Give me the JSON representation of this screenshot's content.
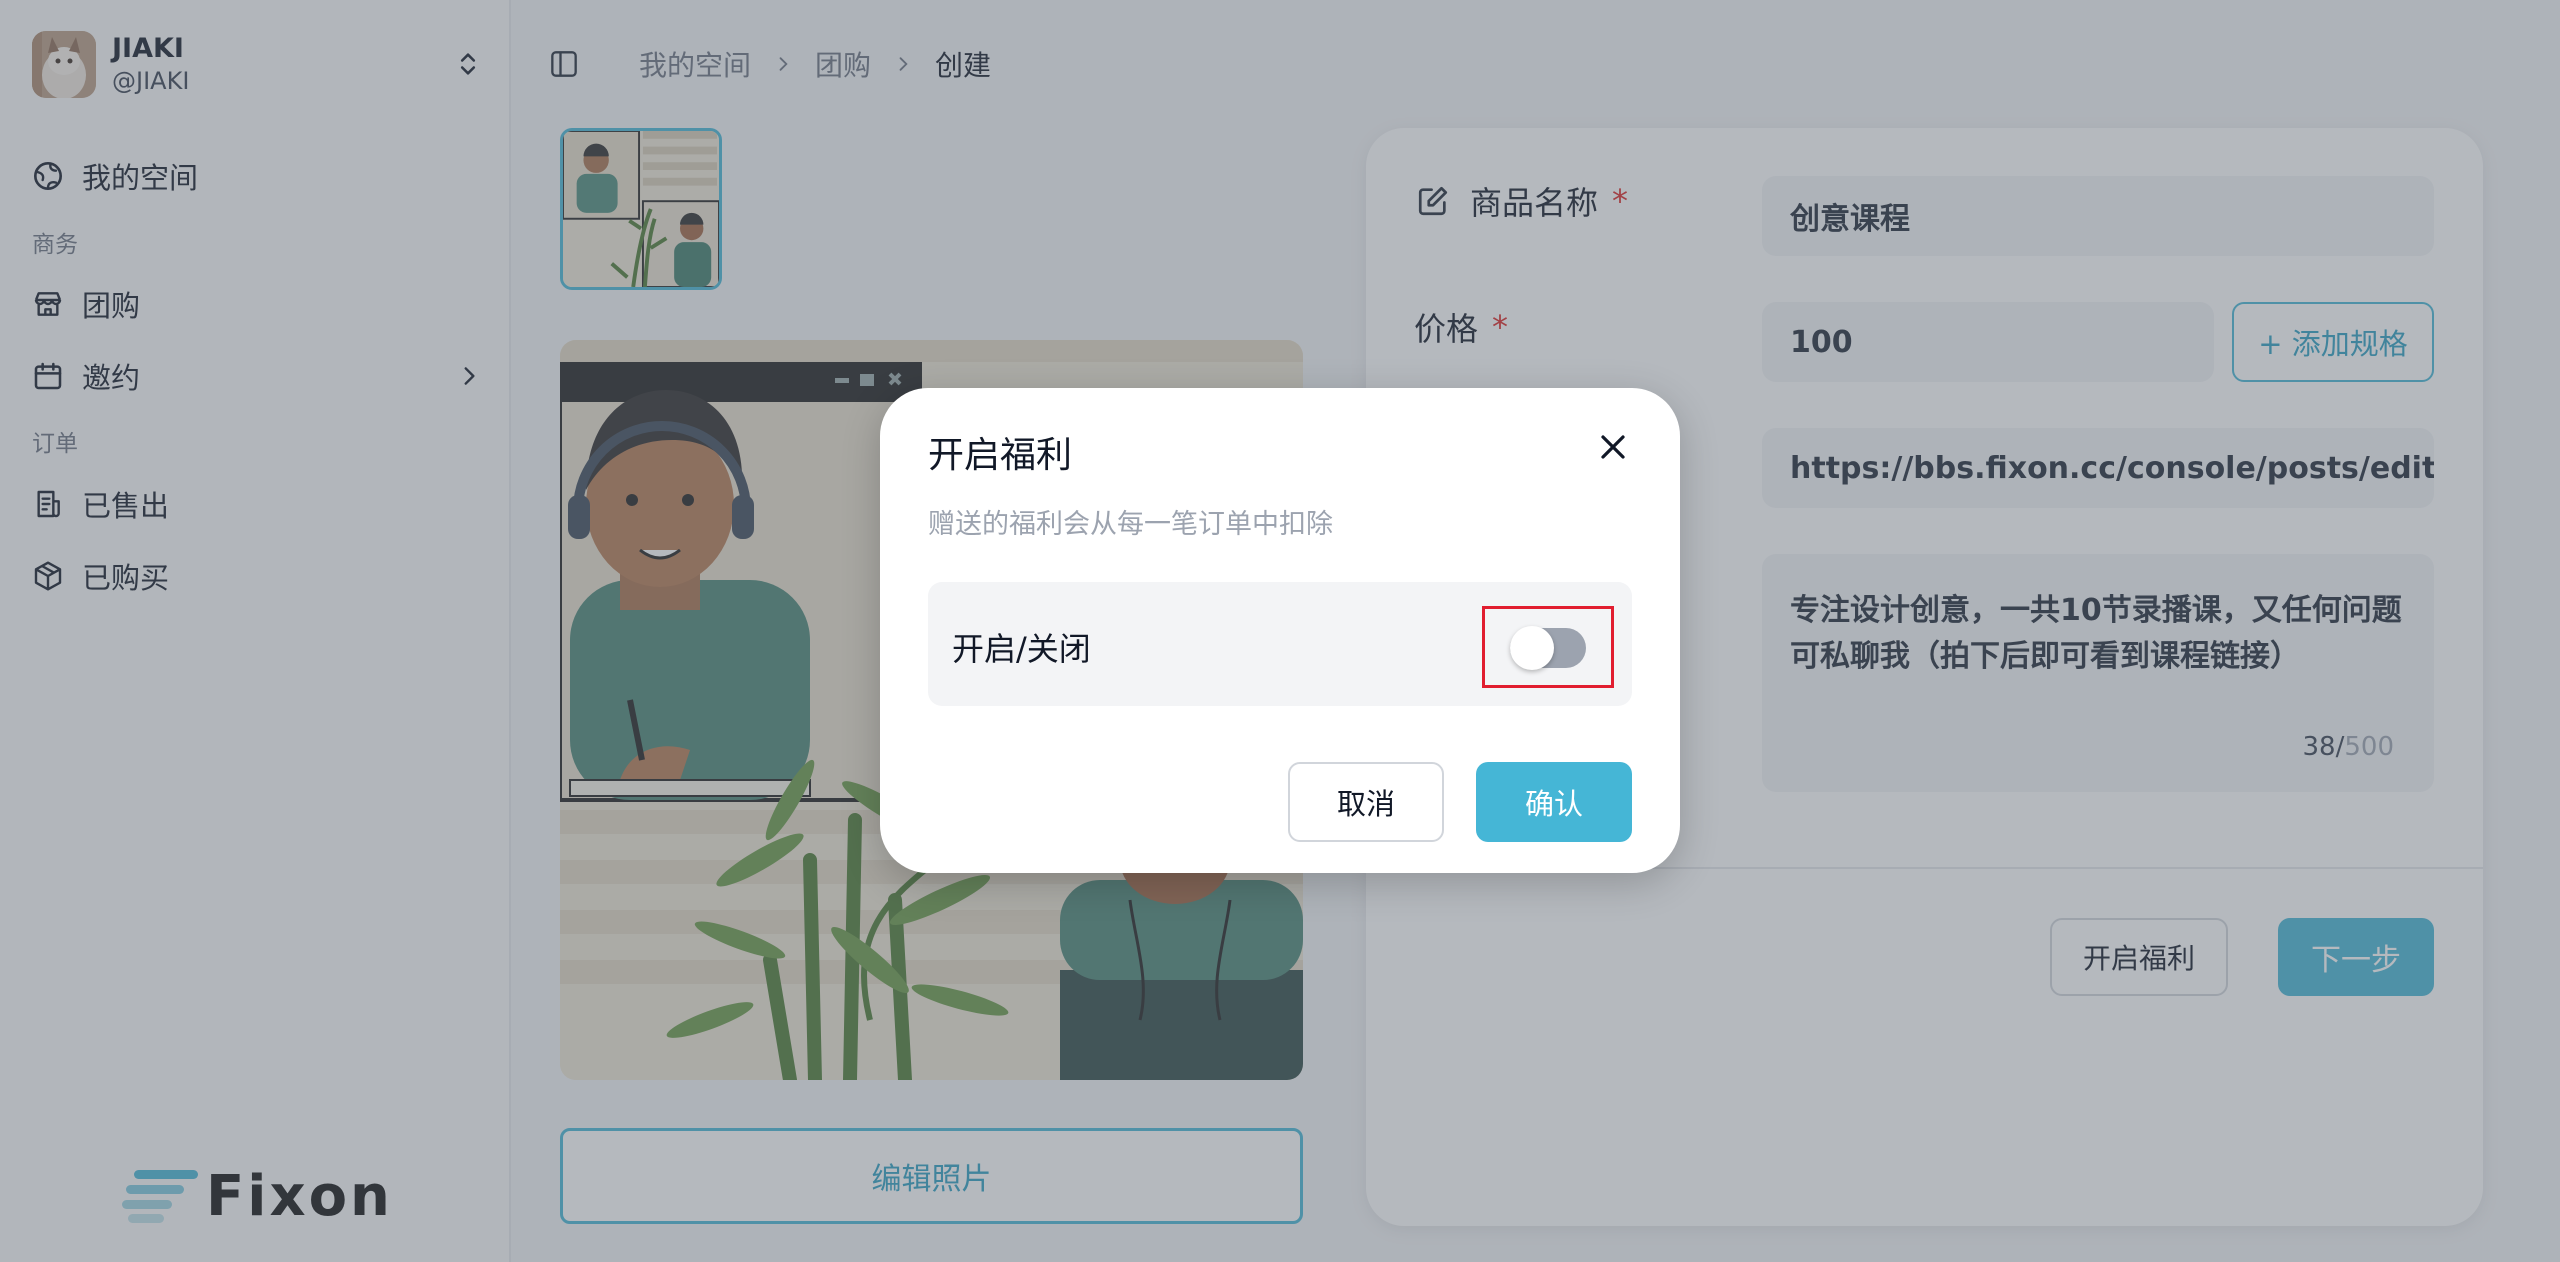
{
  "profile": {
    "name": "JIAKI",
    "handle": "@JIAKI"
  },
  "sidebar": {
    "my_space": "我的空间",
    "section_business": "商务",
    "group_buy": "团购",
    "invite": "邀约",
    "section_orders": "订单",
    "sold": "已售出",
    "purchased": "已购买"
  },
  "logo": {
    "text": "Fixon"
  },
  "breadcrumb": {
    "items": [
      "我的空间",
      "团购",
      "创建"
    ]
  },
  "photo": {
    "edit_label": "编辑照片"
  },
  "form": {
    "name_label": "商品名称",
    "name_value": "创意课程",
    "price_label": "价格",
    "price_value": "100",
    "add_spec_label": "+ 添加规格",
    "link_value": "https://bbs.fixon.cc/console/posts/editor?r",
    "description_value": "专注设计创意，一共10节录播课，又任何问题可私聊我（拍下后即可看到课程链接）",
    "counter_current": "38",
    "counter_max": "500",
    "welfare_label": "开启福利",
    "next_label": "下一步"
  },
  "modal": {
    "title": "开启福利",
    "description": "赠送的福利会从每一笔订单中扣除",
    "toggle_label": "开启/关闭",
    "toggle_on": false,
    "cancel_label": "取消",
    "confirm_label": "确认"
  },
  "colors": {
    "accent": "#45b6d6",
    "required": "#dc2626",
    "highlight": "#e11d2f"
  }
}
